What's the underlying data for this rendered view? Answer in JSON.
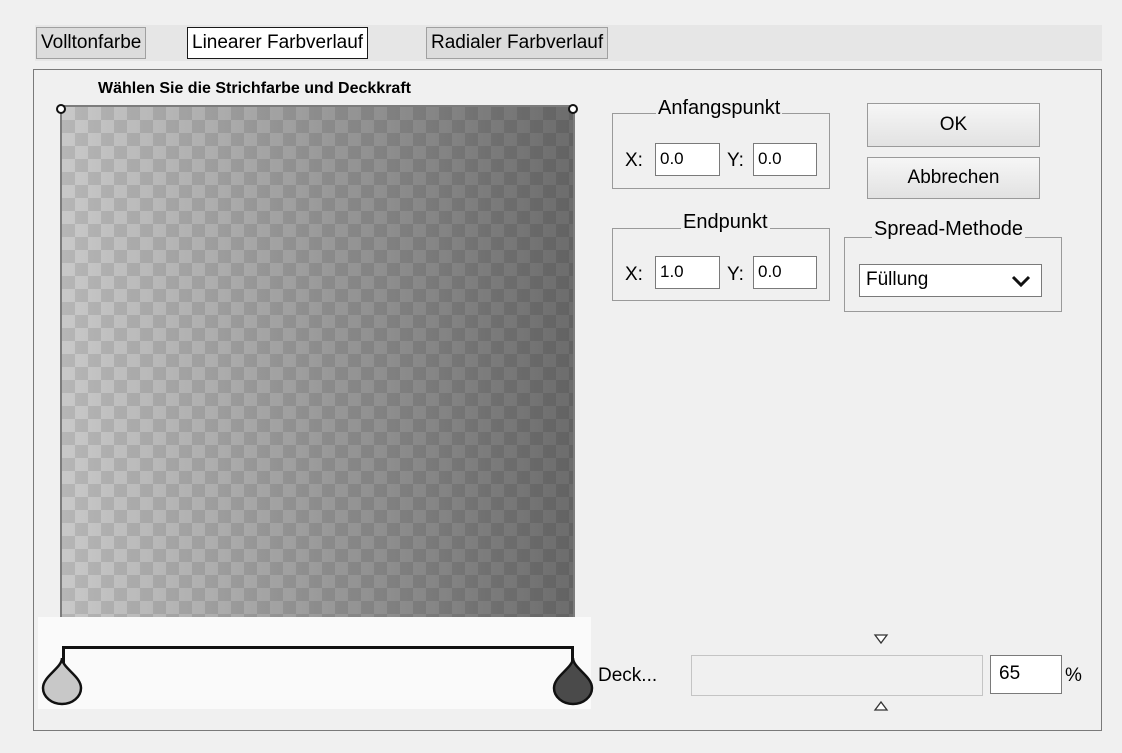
{
  "tabs": [
    {
      "label": "Volltonfarbe",
      "active": false
    },
    {
      "label": "Linearer Farbverlauf",
      "active": true
    },
    {
      "label": "Radialer Farbverlauf",
      "active": false
    }
  ],
  "preview": {
    "title": "Wählen Sie die Strichfarbe und Deckkraft"
  },
  "start_point": {
    "legend": "Anfangspunkt",
    "x_label": "X:",
    "x_value": "0.0",
    "y_label": "Y:",
    "y_value": "0.0"
  },
  "end_point": {
    "legend": "Endpunkt",
    "x_label": "X:",
    "x_value": "1.0",
    "y_label": "Y:",
    "y_value": "0.0"
  },
  "buttons": {
    "ok": "OK",
    "cancel": "Abbrechen"
  },
  "spread": {
    "legend": "Spread-Methode",
    "selected": "Füllung"
  },
  "opacity": {
    "label": "Deck...",
    "value": "65",
    "unit": "%",
    "level": 0.65
  },
  "gradient_stops": [
    {
      "color": "#c8c8c8"
    },
    {
      "color": "#4a4a4a"
    }
  ],
  "colors": {
    "active_tab_border": "#1a1a1a",
    "panel_bg": "#f0f0f0"
  }
}
